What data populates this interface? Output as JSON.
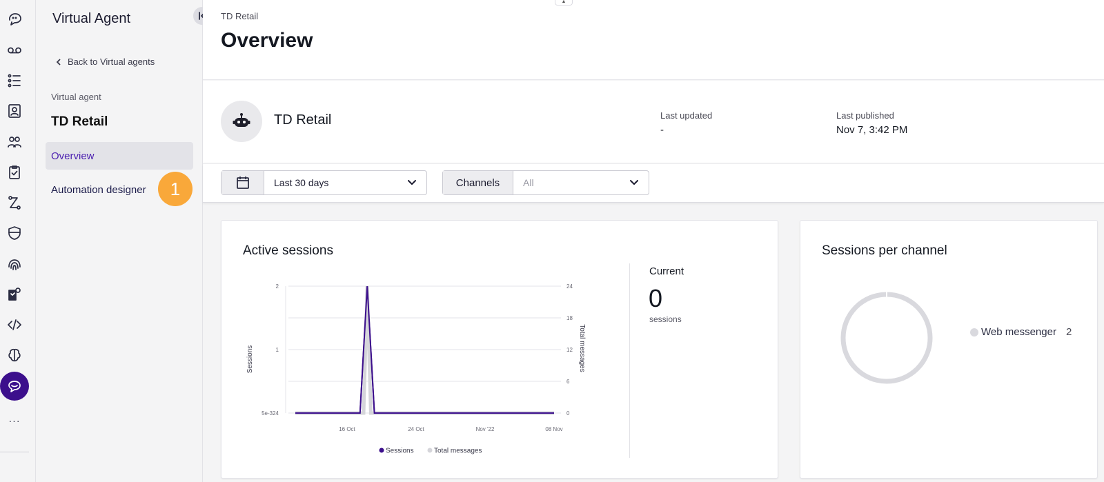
{
  "rail": {
    "items": [
      {
        "name": "conversations-icon"
      },
      {
        "name": "voicemail-icon"
      },
      {
        "name": "queues-icon"
      },
      {
        "name": "contacts-icon"
      },
      {
        "name": "users-icon"
      },
      {
        "name": "tasks-icon"
      },
      {
        "name": "routing-icon"
      },
      {
        "name": "security-icon"
      },
      {
        "name": "fingerprint-icon"
      },
      {
        "name": "settings-doc-icon"
      },
      {
        "name": "code-icon"
      },
      {
        "name": "brain-icon"
      },
      {
        "name": "virtual-agent-icon",
        "active": true
      }
    ],
    "more": "···"
  },
  "subnav": {
    "title": "Virtual Agent",
    "back_label": "Back to Virtual agents",
    "section_label": "Virtual agent",
    "agent_name": "TD Retail",
    "items": [
      {
        "label": "Overview",
        "active": true
      },
      {
        "label": "Automation designer",
        "active": false
      }
    ],
    "step_badge": "1"
  },
  "header": {
    "breadcrumb": "TD Retail",
    "title": "Overview"
  },
  "agent": {
    "name": "TD Retail",
    "last_updated_label": "Last updated",
    "last_updated_value": "-",
    "last_published_label": "Last published",
    "last_published_value": "Nov 7, 3:42 PM"
  },
  "filters": {
    "date_value": "Last 30 days",
    "channels_label": "Channels",
    "channels_value": "All"
  },
  "active_sessions": {
    "title": "Active sessions",
    "current_label": "Current",
    "current_value": "0",
    "current_unit": "sessions"
  },
  "sessions_per_channel": {
    "title": "Sessions per channel",
    "legend_label": "Web messenger",
    "legend_count": "2"
  },
  "colors": {
    "accent": "#3c0f8c",
    "sessions_line": "#3c0f8c",
    "messages_line": "#d5d5da",
    "badge": "#f9a83a"
  },
  "chart_data": [
    {
      "type": "line",
      "title": "",
      "ylabel": "Sessions",
      "y2label": "Total messages",
      "x_tick_labels": [
        "16 Oct",
        "24 Oct",
        "Nov '22",
        "08 Nov"
      ],
      "y_tick_labels": [
        "5e-324",
        "1",
        "2"
      ],
      "y2_tick_labels": [
        "0",
        "6",
        "12",
        "18",
        "24"
      ],
      "ylim": [
        0,
        2
      ],
      "y2lim": [
        0,
        24
      ],
      "series": [
        {
          "name": "Sessions",
          "axis": "left",
          "color": "#3c0f8c",
          "x": [
            0,
            9,
            10,
            11,
            36
          ],
          "values": [
            0,
            0,
            2,
            0,
            0
          ]
        },
        {
          "name": "Total messages",
          "axis": "right",
          "color": "#d5d5da",
          "x": [
            0,
            9.5,
            10,
            10.5,
            36
          ],
          "values": [
            0,
            0,
            24,
            0,
            0
          ]
        }
      ],
      "legend": "bottom-center"
    },
    {
      "type": "pie",
      "title": "Sessions per channel",
      "categories": [
        "Web messenger"
      ],
      "values": [
        2
      ],
      "donut": true,
      "legend": "right"
    }
  ]
}
